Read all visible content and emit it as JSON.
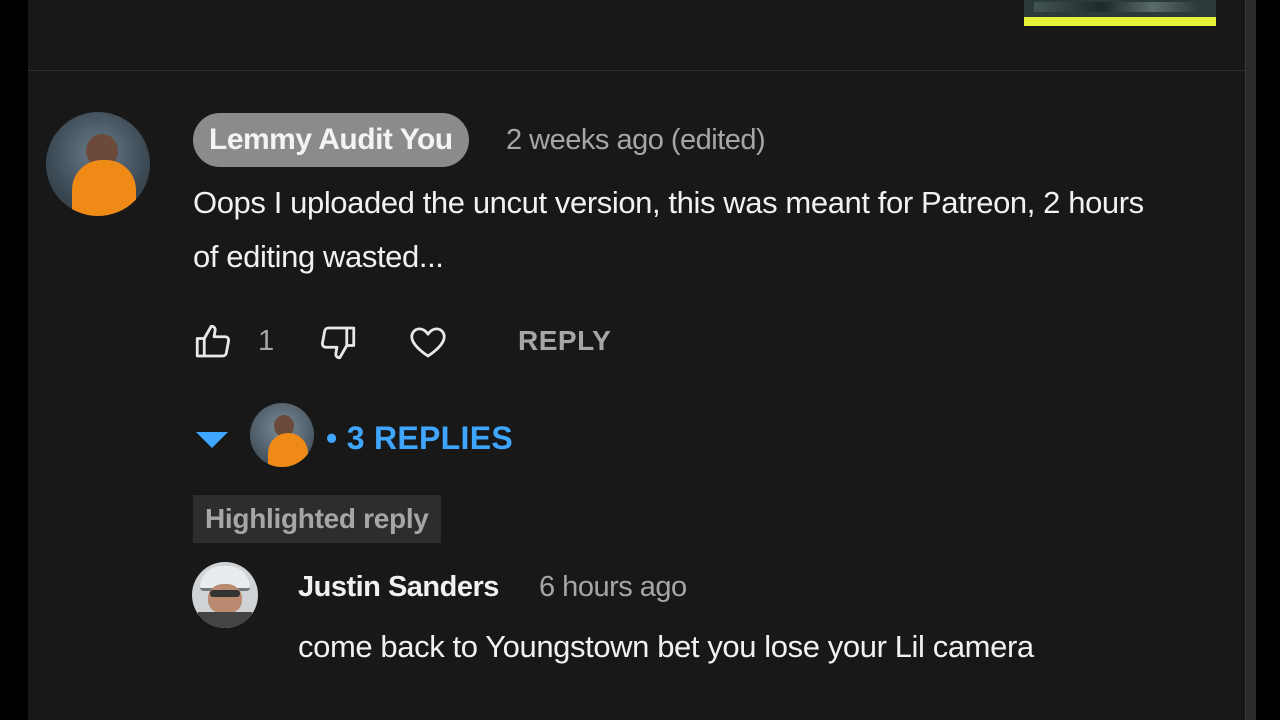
{
  "comment": {
    "author": "Lemmy Audit You",
    "timestamp": "2 weeks ago (edited)",
    "text": "Oops I uploaded the uncut version, this was meant for Patreon, 2 hours of editing wasted...",
    "like_count": "1",
    "reply_label": "REPLY"
  },
  "replies_toggle": {
    "label": "• 3 REPLIES",
    "color": "#3ea6ff"
  },
  "highlighted_reply": {
    "badge": "Highlighted reply",
    "author": "Justin Sanders",
    "timestamp": "6 hours ago",
    "text": "come back to Youngstown bet you lose your Lil camera"
  },
  "icons": {
    "like": "thumbs-up-icon",
    "dislike": "thumbs-down-icon",
    "heart": "heart-icon",
    "expand": "caret-down-icon"
  },
  "colors": {
    "background": "#181818",
    "author_chip": "#8b8b8b",
    "text_primary": "#f1f1f1",
    "text_secondary": "#a6a6a6",
    "accent": "#3ea6ff"
  }
}
